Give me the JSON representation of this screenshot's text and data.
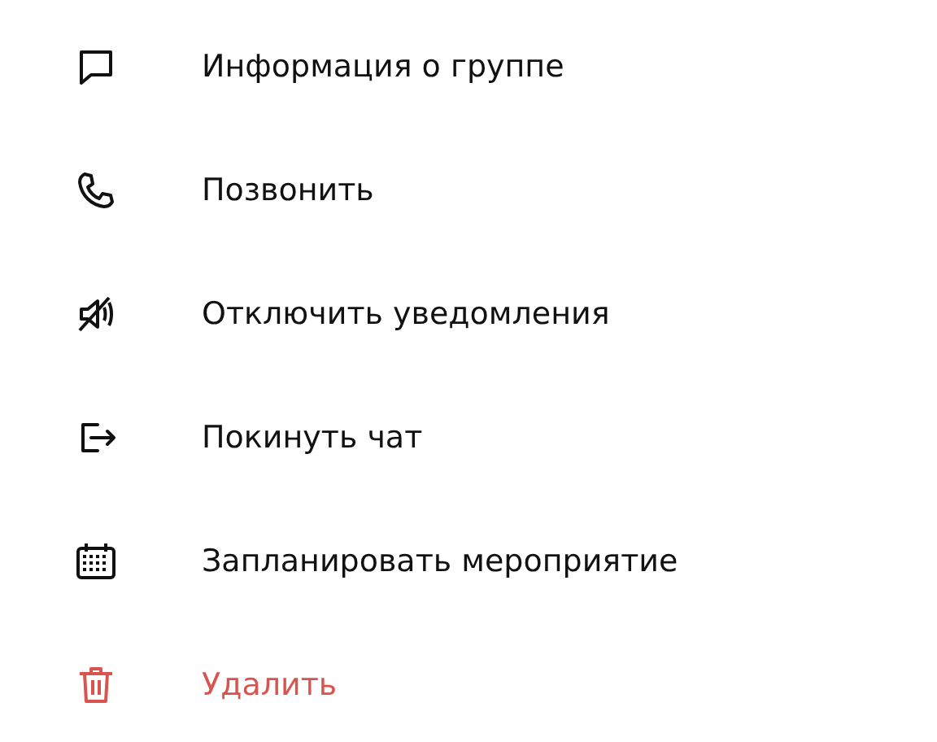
{
  "menu": {
    "items": [
      {
        "label": "Информация о группе",
        "kind": "normal"
      },
      {
        "label": "Позвонить",
        "kind": "normal"
      },
      {
        "label": "Отключить уведомления",
        "kind": "normal"
      },
      {
        "label": "Покинуть чат",
        "kind": "normal"
      },
      {
        "label": "Запланировать мероприятие",
        "kind": "normal"
      },
      {
        "label": "Удалить",
        "kind": "danger"
      }
    ]
  }
}
